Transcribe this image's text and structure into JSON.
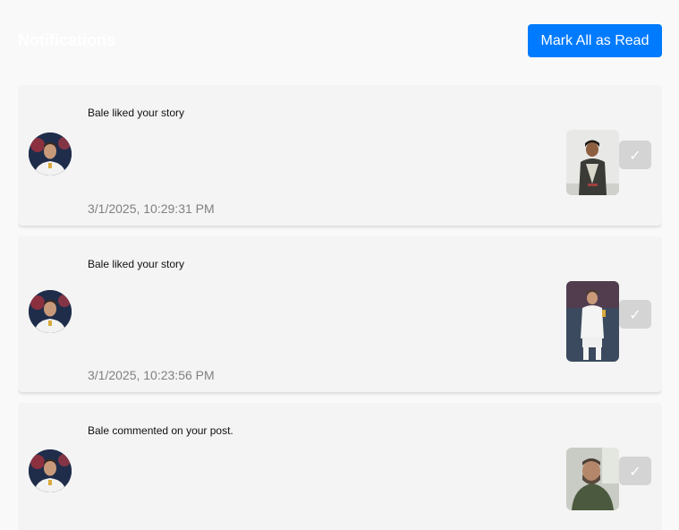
{
  "header": {
    "title": "Notifications",
    "mark_all_label": "Mark All as Read"
  },
  "colors": {
    "accent": "#007bff",
    "card_bg": "#f4f4f4",
    "check_bg": "#d4d4d4",
    "timestamp": "#808080"
  },
  "notifications": [
    {
      "message": "Bale liked your story",
      "timestamp": "3/1/2025, 10:29:31 PM",
      "check_icon": "✓"
    },
    {
      "message": "Bale liked your story",
      "timestamp": "3/1/2025, 10:23:56 PM",
      "check_icon": "✓"
    },
    {
      "message": "Bale commented on your post.",
      "timestamp": "",
      "check_icon": "✓"
    }
  ]
}
